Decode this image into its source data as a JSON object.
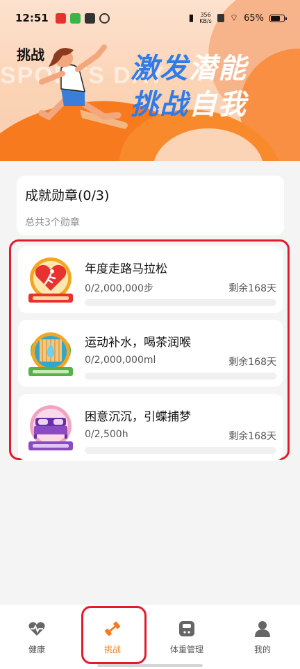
{
  "status_bar": {
    "time": "12:51",
    "net_speed_value": "356",
    "net_speed_unit": "KB/s",
    "battery": "65%"
  },
  "header": {
    "title": "挑战",
    "bg_text": "SPORTS DAY",
    "slogan_line1_a": "激发",
    "slogan_line1_b": "潜能",
    "slogan_line2_a": "挑战",
    "slogan_line2_b": "自我"
  },
  "summary": {
    "title": "成就勋章(0/3)",
    "subtitle": "总共3个勋章"
  },
  "badges": [
    {
      "title": "年度走路马拉松",
      "progress_text": "0/2,000,000步",
      "remaining": "剩余168天",
      "progress": 0,
      "medal_label": "年度走路马拉松",
      "medal_icon": "runner-heart-icon",
      "medal_colors": {
        "ring": "#f2a623",
        "core": "#e8322d",
        "ribbon": "#e8322d"
      }
    },
    {
      "title": "运动补水，喝茶润喉",
      "progress_text": "0/2,000,000ml",
      "remaining": "剩余168天",
      "progress": 0,
      "medal_label": "运动补水喝茶润喉",
      "medal_icon": "water-drop-icon",
      "medal_colors": {
        "ring": "#f2a623",
        "core": "#34a7c9",
        "ribbon": "#55b24a"
      }
    },
    {
      "title": "困意沉沉，引蝶捕梦",
      "progress_text": "0/2,500h",
      "remaining": "剩余168天",
      "progress": 0,
      "medal_label": "困意沉沉引蝶捕梦",
      "medal_icon": "bed-icon",
      "medal_colors": {
        "ring": "#f1a3c3",
        "core": "#8a4bc2",
        "ribbon": "#8a4bc2"
      }
    }
  ],
  "bottom_nav": [
    {
      "label": "健康",
      "icon": "heart-pulse-icon",
      "active": false
    },
    {
      "label": "挑战",
      "icon": "dumbbell-icon",
      "active": true
    },
    {
      "label": "体重管理",
      "icon": "scale-icon",
      "active": false
    },
    {
      "label": "我的",
      "icon": "person-icon",
      "active": false
    }
  ],
  "colors": {
    "accent": "#f77a1f",
    "highlight_box": "#e21b2c",
    "slogan_blue": "#2f7be8"
  }
}
